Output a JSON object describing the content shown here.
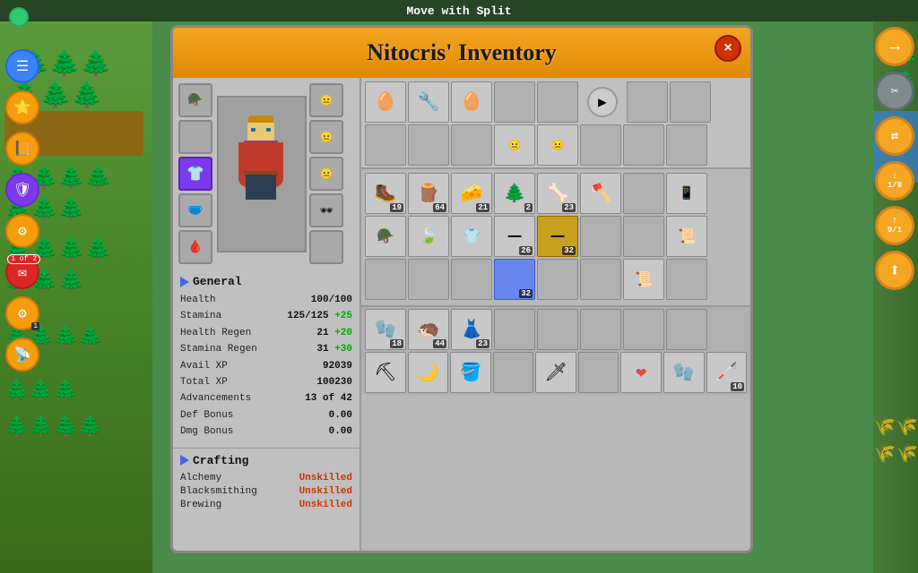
{
  "window": {
    "title": "Move with Split",
    "modal_title": "Nitocris' Inventory",
    "close_label": "×"
  },
  "character": {
    "name": "Nitocris"
  },
  "stats": {
    "section_label": "General",
    "health_label": "Health",
    "health_value": "100/100",
    "stamina_label": "Stamina",
    "stamina_value": "125/125",
    "stamina_bonus": "+25",
    "health_regen_label": "Health Regen",
    "health_regen_value": "21",
    "health_regen_bonus": "+20",
    "stamina_regen_label": "Stamina Regen",
    "stamina_regen_value": "31",
    "stamina_regen_bonus": "+30",
    "avail_xp_label": "Avail XP",
    "avail_xp_value": "92039",
    "total_xp_label": "Total XP",
    "total_xp_value": "100230",
    "advancements_label": "Advancements",
    "advancements_value": "13 of 42",
    "def_bonus_label": "Def Bonus",
    "def_bonus_value": "0.00",
    "dmg_bonus_label": "Dmg Bonus",
    "dmg_bonus_value": "0.00"
  },
  "crafting": {
    "section_label": "Crafting",
    "alchemy_label": "Alchemy",
    "alchemy_value": "Unskilled",
    "blacksmithing_label": "Blacksmithing",
    "blacksmithing_value": "Unskilled",
    "brewing_label": "Brewing",
    "brewing_value": "Unskilled"
  },
  "inventory": {
    "nav_arrow": "▶",
    "top_row_items": [
      {
        "icon": "🥚",
        "count": ""
      },
      {
        "icon": "🔧",
        "count": ""
      },
      {
        "icon": "🥚",
        "count": ""
      },
      {
        "icon": "",
        "count": ""
      },
      {
        "icon": "",
        "count": ""
      },
      {
        "icon": "",
        "count": ""
      },
      {
        "icon": "",
        "count": ""
      },
      {
        "icon": "",
        "count": ""
      }
    ],
    "second_row_items": [
      {
        "icon": "",
        "count": ""
      },
      {
        "icon": "",
        "count": ""
      },
      {
        "icon": "",
        "count": ""
      },
      {
        "icon": "😐",
        "count": ""
      },
      {
        "icon": "😐",
        "count": ""
      },
      {
        "icon": "",
        "count": ""
      },
      {
        "icon": "",
        "count": ""
      },
      {
        "icon": "",
        "count": ""
      }
    ],
    "main_items": [
      {
        "icon": "🥾",
        "count": "19",
        "slot": 0
      },
      {
        "icon": "🪵",
        "count": "64",
        "slot": 1
      },
      {
        "icon": "🧀",
        "count": "21",
        "slot": 2
      },
      {
        "icon": "🌲",
        "count": "2",
        "slot": 3
      },
      {
        "icon": "🦴",
        "count": "23",
        "slot": 4
      },
      {
        "icon": "🪓",
        "count": "",
        "slot": 5
      },
      {
        "icon": "",
        "count": "",
        "slot": 6
      },
      {
        "icon": "📱",
        "count": "",
        "slot": 7
      },
      {
        "icon": "🪖",
        "count": "",
        "slot": 8
      },
      {
        "icon": "🍃",
        "count": "",
        "slot": 9
      },
      {
        "icon": "👕",
        "count": "",
        "slot": 10
      },
      {
        "icon": "═",
        "count": "26",
        "slot": 11
      },
      {
        "icon": "━",
        "count": "32",
        "slot": 12
      },
      {
        "icon": "",
        "count": "",
        "slot": 13
      },
      {
        "icon": "",
        "count": "",
        "slot": 14
      },
      {
        "icon": "📜",
        "count": "",
        "slot": 15
      },
      {
        "icon": "",
        "count": "",
        "slot": 16
      },
      {
        "icon": "",
        "count": "",
        "slot": 17
      },
      {
        "icon": "",
        "count": "",
        "slot": 18
      },
      {
        "icon": "",
        "count": "32",
        "slot": 19,
        "selected": true
      },
      {
        "icon": "",
        "count": "",
        "slot": 20
      },
      {
        "icon": "",
        "count": "",
        "slot": 21
      },
      {
        "icon": "📜",
        "count": "",
        "slot": 22
      },
      {
        "icon": "",
        "count": "",
        "slot": 23
      }
    ],
    "bottom_items": [
      {
        "icon": "🧤",
        "count": "18",
        "slot": 0
      },
      {
        "icon": "🦔",
        "count": "44",
        "slot": 1
      },
      {
        "icon": "👗",
        "count": "23",
        "slot": 2
      },
      {
        "icon": "",
        "count": "",
        "slot": 3
      },
      {
        "icon": "",
        "count": "",
        "slot": 4
      },
      {
        "icon": "",
        "count": "",
        "slot": 5
      },
      {
        "icon": "",
        "count": "",
        "slot": 6
      },
      {
        "icon": "",
        "count": "",
        "slot": 7
      }
    ],
    "tool_items": [
      {
        "icon": "⛏",
        "count": "",
        "slot": 0
      },
      {
        "icon": "🌙",
        "count": "",
        "slot": 1
      },
      {
        "icon": "🪣",
        "count": "",
        "slot": 2
      },
      {
        "icon": "",
        "count": "",
        "slot": 3
      },
      {
        "icon": "🗡",
        "count": "",
        "slot": 4
      },
      {
        "icon": "",
        "count": "",
        "slot": 5
      },
      {
        "icon": "❤",
        "count": "",
        "slot": 6
      },
      {
        "icon": "🧤",
        "count": "",
        "slot": 7
      },
      {
        "icon": "🦯",
        "count": "10",
        "slot": 8
      }
    ]
  },
  "left_ui": {
    "mail_badge": "1 of 2",
    "bottom_num": "1"
  },
  "right_ui": {
    "arrow_right": "→",
    "tools_icon": "✂",
    "swap_icon": "⇄",
    "down_icon": "↓9↑",
    "up_icon": "↑9↓",
    "move_icon": "⬆"
  }
}
